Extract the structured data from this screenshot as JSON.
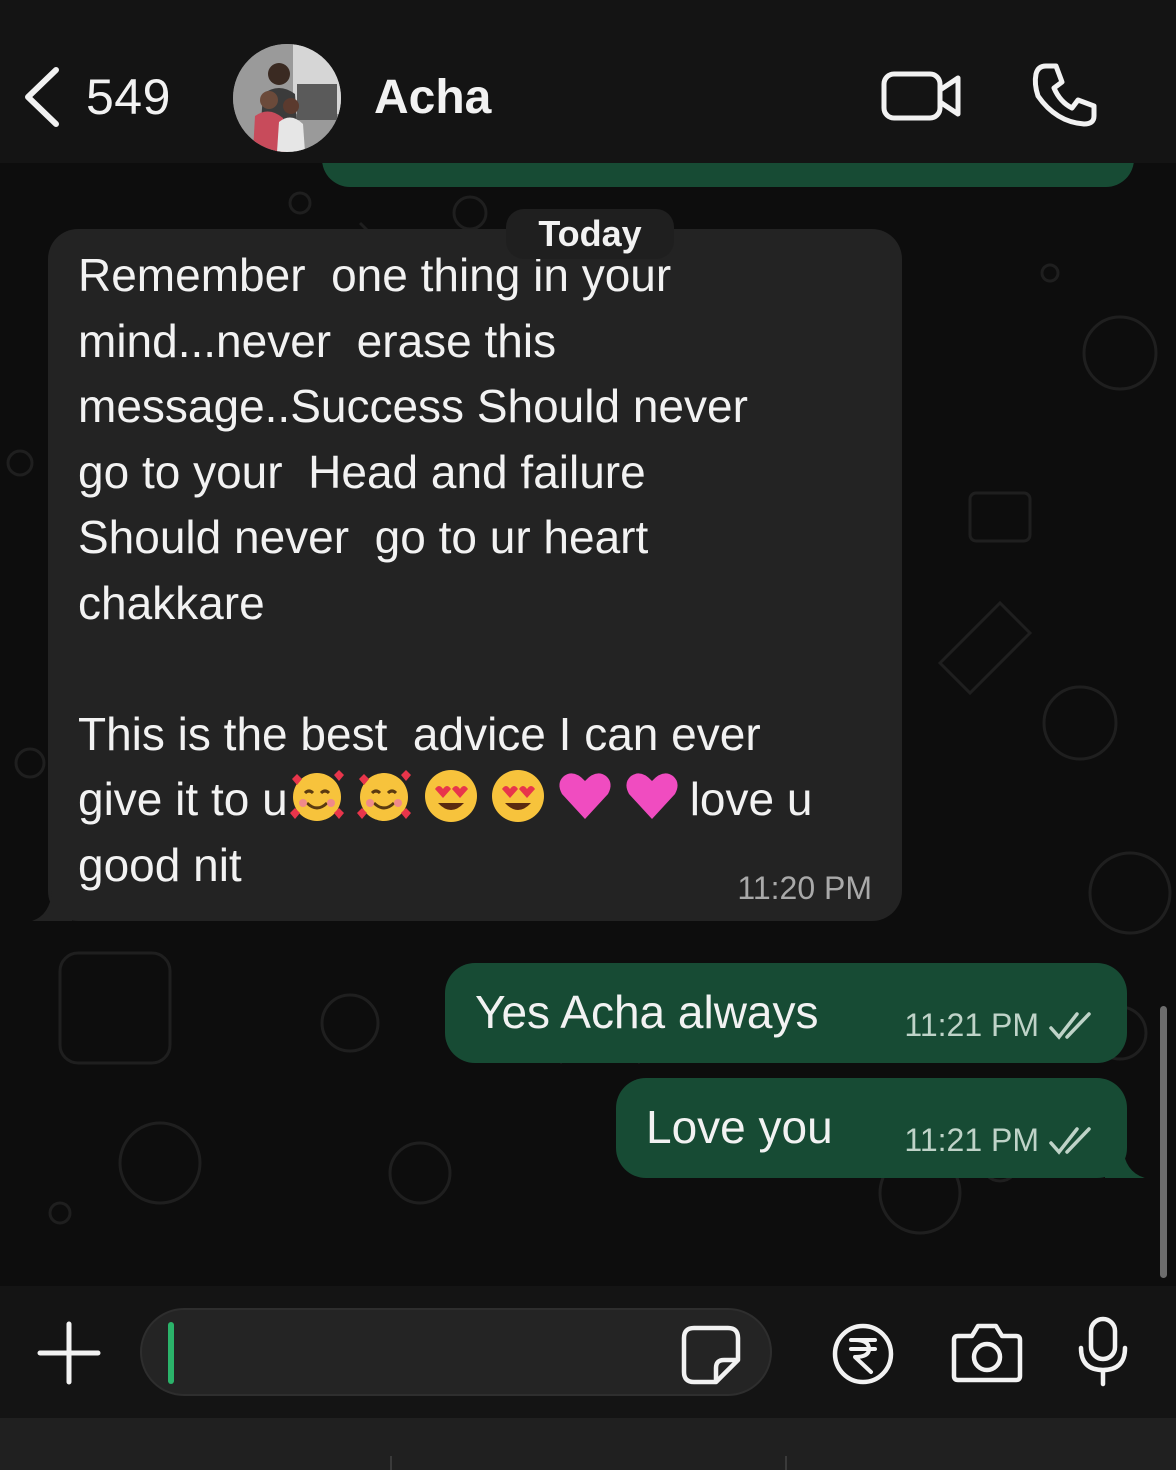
{
  "header": {
    "back_count": "549",
    "contact_name": "Acha"
  },
  "chat": {
    "date_chip": "Today",
    "incoming": {
      "line1": "Remember  one thing in your",
      "line2": "mind...never  erase this",
      "line3": "message..Success Should never",
      "line4": "go to your  Head and failure",
      "line5": "Should never  go to ur heart",
      "line6": "chakkare",
      "line7": "This is the best  advice I can ever",
      "line8_prefix": "give it to u",
      "line8_suffix": "love u",
      "line9": "good nit",
      "emojis": [
        "smiling-face-with-hearts",
        "smiling-face-with-hearts",
        "heart-eyes",
        "heart-eyes",
        "pink-heart",
        "pink-heart"
      ],
      "time": "11:20 PM"
    },
    "outgoing": [
      {
        "text": "Yes Acha always",
        "time": "11:21 PM",
        "status": "read"
      },
      {
        "text": "Love you",
        "time": "11:21 PM",
        "status": "read"
      }
    ]
  },
  "colors": {
    "outgoing_bubble": "#174b34",
    "incoming_bubble": "#232323",
    "accent": "#2bb36a"
  }
}
